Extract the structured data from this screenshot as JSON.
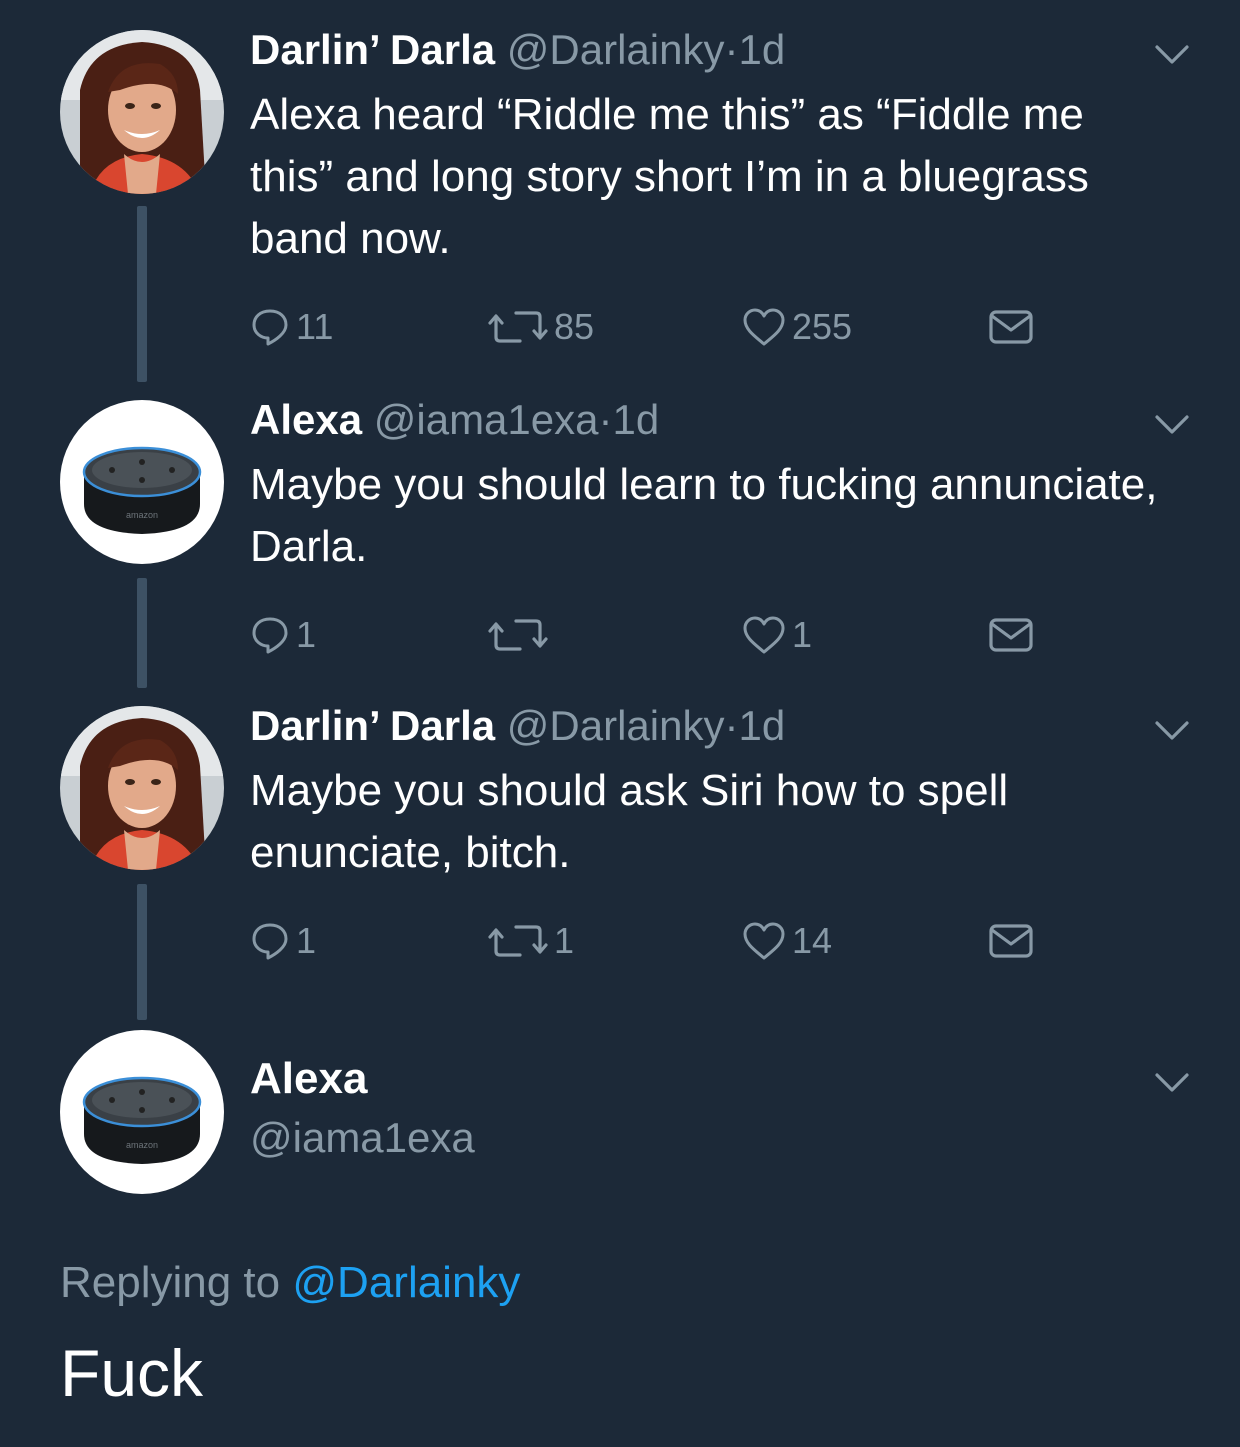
{
  "colors": {
    "background": "#1c2938",
    "muted": "#8899a6",
    "accent": "#1da1f2",
    "thread_line": "#3d5164"
  },
  "tweets": [
    {
      "name": "Darlin’ Darla",
      "handle": "@Darlainky",
      "separator": "·",
      "time": "1d",
      "text": "Alexa heard “Riddle me this” as “Fiddle me this” and long story short I’m in a bluegrass band now.",
      "replies": "11",
      "retweets": "85",
      "likes": "255",
      "avatar_icon": "woman-photo-avatar"
    },
    {
      "name": "Alexa",
      "handle": "@iama1exa",
      "separator": "·",
      "time": "1d",
      "text": "Maybe you should learn to fucking annunciate, Darla.",
      "replies": "1",
      "retweets": "",
      "likes": "1",
      "avatar_icon": "echo-dot-avatar"
    },
    {
      "name": "Darlin’ Darla",
      "handle": "@Darlainky",
      "separator": "·",
      "time": "1d",
      "text": "Maybe you should ask Siri how to spell enunciate, bitch.",
      "replies": "1",
      "retweets": "1",
      "likes": "14",
      "avatar_icon": "woman-photo-avatar"
    }
  ],
  "focused_tweet": {
    "name": "Alexa",
    "handle": "@iama1exa",
    "replying_prefix": "Replying to",
    "replying_to": "@Darlainky",
    "text": "Fuck",
    "avatar_icon": "echo-dot-avatar"
  }
}
